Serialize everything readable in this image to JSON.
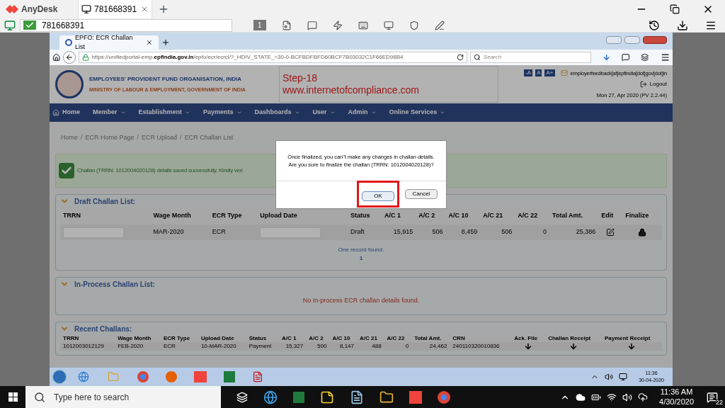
{
  "anydesk": {
    "app_name": "AnyDesk",
    "tab_label": "781668391",
    "address": "781668391",
    "monitor_number": "1"
  },
  "browser": {
    "tab_title": "EPFO: ECR Challan List",
    "url_prefix": "https://unifiedportal-emp.",
    "url_domain": "epfindia.gov.in",
    "url_rest": "/epfo/ecr/ecrcl/?_HDIV_STATE_=30-0-BCFBDFBFD60BCF7B03032C1F66ED98B4",
    "search_placeholder": "Search"
  },
  "header": {
    "org_name": "EMPLOYEES' PROVIDENT FUND ORGANISATION, INDIA",
    "ministry": "MINISTRY OF LABOUR & EMPLOYMENT, GOVERNMENT OF INDIA",
    "note_step": "Step-18",
    "note_site": "www.internetofcompliance.com",
    "font_buttons": [
      "-A",
      "A",
      "A+"
    ],
    "email": "employerfeedback[at]epfindia[dot]gov[dot]in",
    "logout": "Logout",
    "date": "Mon 27, Apr 2020 (PV 2.2.44)"
  },
  "nav": [
    {
      "label": "Home",
      "kind": "home"
    },
    {
      "label": "Member",
      "kind": "menu"
    },
    {
      "label": "Establishment",
      "kind": "menu"
    },
    {
      "label": "Payments",
      "kind": "menu"
    },
    {
      "label": "Dashboards",
      "kind": "menu"
    },
    {
      "label": "User",
      "kind": "menu"
    },
    {
      "label": "Admin",
      "kind": "menu"
    },
    {
      "label": "Online Services",
      "kind": "menu"
    }
  ],
  "breadcrumb": [
    "Home",
    "ECR Home Page",
    "ECR Upload",
    "ECR Challan List"
  ],
  "breadcrumb_separator": "/",
  "alert": "Challan (TRRN: 1012004020128) details saved successfully. Kindly veri",
  "draft": {
    "title": "Draft Challan List:",
    "columns": [
      "TRRN",
      "Wage Month",
      "ECR Type",
      "Upload Date",
      "Status",
      "A/C 1",
      "A/C 2",
      "A/C 10",
      "A/C 21",
      "A/C 22",
      "Total Amt.",
      "Edit",
      "Finalize"
    ],
    "rows": [
      [
        {
          "kind": "redacted"
        },
        {
          "kind": "text",
          "text": "MAR-2020"
        },
        {
          "kind": "text",
          "text": "ECR"
        },
        {
          "kind": "redacted"
        },
        {
          "kind": "text",
          "text": "Draft"
        },
        {
          "kind": "num",
          "text": "15,915"
        },
        {
          "kind": "num",
          "text": "506"
        },
        {
          "kind": "num",
          "text": "8,459"
        },
        {
          "kind": "num",
          "text": "506"
        },
        {
          "kind": "num",
          "text": "0"
        },
        {
          "kind": "num",
          "text": "25,386"
        },
        {
          "kind": "edit"
        },
        {
          "kind": "lock"
        }
      ]
    ],
    "footer": "One record found.",
    "page": "1"
  },
  "inprocess": {
    "title": "In-Process Challan List:",
    "message": "No In-process ECR challan details found."
  },
  "recent": {
    "title": "Recent Challans:",
    "columns": [
      "TRRN",
      "Wage Month",
      "ECR Type",
      "Upload Date",
      "Status",
      "A/C 1",
      "A/C 2",
      "A/C 10",
      "A/C 21",
      "A/C 22",
      "Total Amt.",
      "CRN",
      "Ack. File",
      "Challan Receipt",
      "Payment Receipt"
    ],
    "rows": [
      [
        {
          "kind": "text",
          "text": "1012003012129"
        },
        {
          "kind": "text",
          "text": "FEB-2020"
        },
        {
          "kind": "text",
          "text": "ECR"
        },
        {
          "kind": "text",
          "text": "10-MAR-2020"
        },
        {
          "kind": "text",
          "text": "Payment"
        },
        {
          "kind": "num",
          "text": "15,327"
        },
        {
          "kind": "num",
          "text": "500"
        },
        {
          "kind": "num",
          "text": "8,147"
        },
        {
          "kind": "num",
          "text": "488"
        },
        {
          "kind": "num",
          "text": "0"
        },
        {
          "kind": "num",
          "text": "24,462"
        },
        {
          "kind": "text",
          "text": "240110320010836"
        },
        {
          "kind": "download"
        },
        {
          "kind": "download"
        },
        {
          "kind": "download"
        }
      ]
    ]
  },
  "dialog": {
    "lines": [
      "Once finalized, you can\"t make any changes in challan details.",
      "Are you sure to finalize the challan (TRRN: 1012004020128)?"
    ],
    "ok": "OK",
    "cancel": "Cancel",
    "ok_highlighted": true
  },
  "remote_taskbar": {
    "time": "11:36",
    "date": "30-04-2020"
  },
  "taskbar": {
    "search_placeholder": "Type here to search",
    "time": "11:36 AM",
    "date": "4/30/2020",
    "notifications": "22"
  }
}
